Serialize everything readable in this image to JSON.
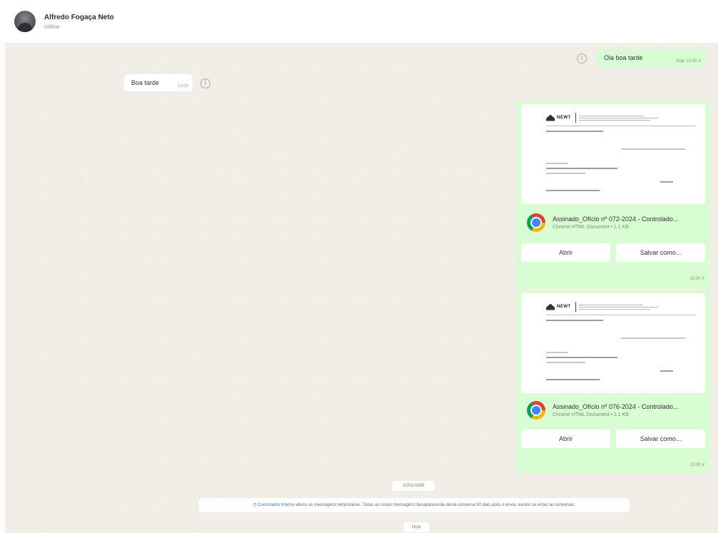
{
  "header": {
    "contact_name": "Alfredo Fogaça Neto",
    "status": "online"
  },
  "messages": {
    "outgoing_greeting": {
      "text": "Ola boa tarde",
      "meta": "Hoje 13:00 ✔"
    },
    "incoming_greeting": {
      "text": "Boa tarde",
      "meta": "13:00"
    },
    "documents": [
      {
        "file_name": "Assinado_Ofício nº 072-2024 - Controlado...",
        "file_type": "Chrome HTML Document • 1.1 KB",
        "open_label": "Abrir",
        "save_label": "Salvar como...",
        "time": "13:00 ✔"
      },
      {
        "file_name": "Assinado_Ofício nº 076-2024 - Controlado...",
        "file_type": "Chrome HTML Document • 1.1 KB",
        "open_label": "Abrir",
        "save_label": "Salvar como...",
        "time": "13:00 ✔"
      }
    ]
  },
  "preview": {
    "brand": "NEWT"
  },
  "date_separator": "02/01/1989",
  "system_message": {
    "link": "Controlador Interno",
    "text": "ativou as mensagens temporárias. Todas as novas mensagens desaparecerão desta conversa 90 dias após o envio, exceto se estas se conversas."
  },
  "today_label": "Hoje"
}
